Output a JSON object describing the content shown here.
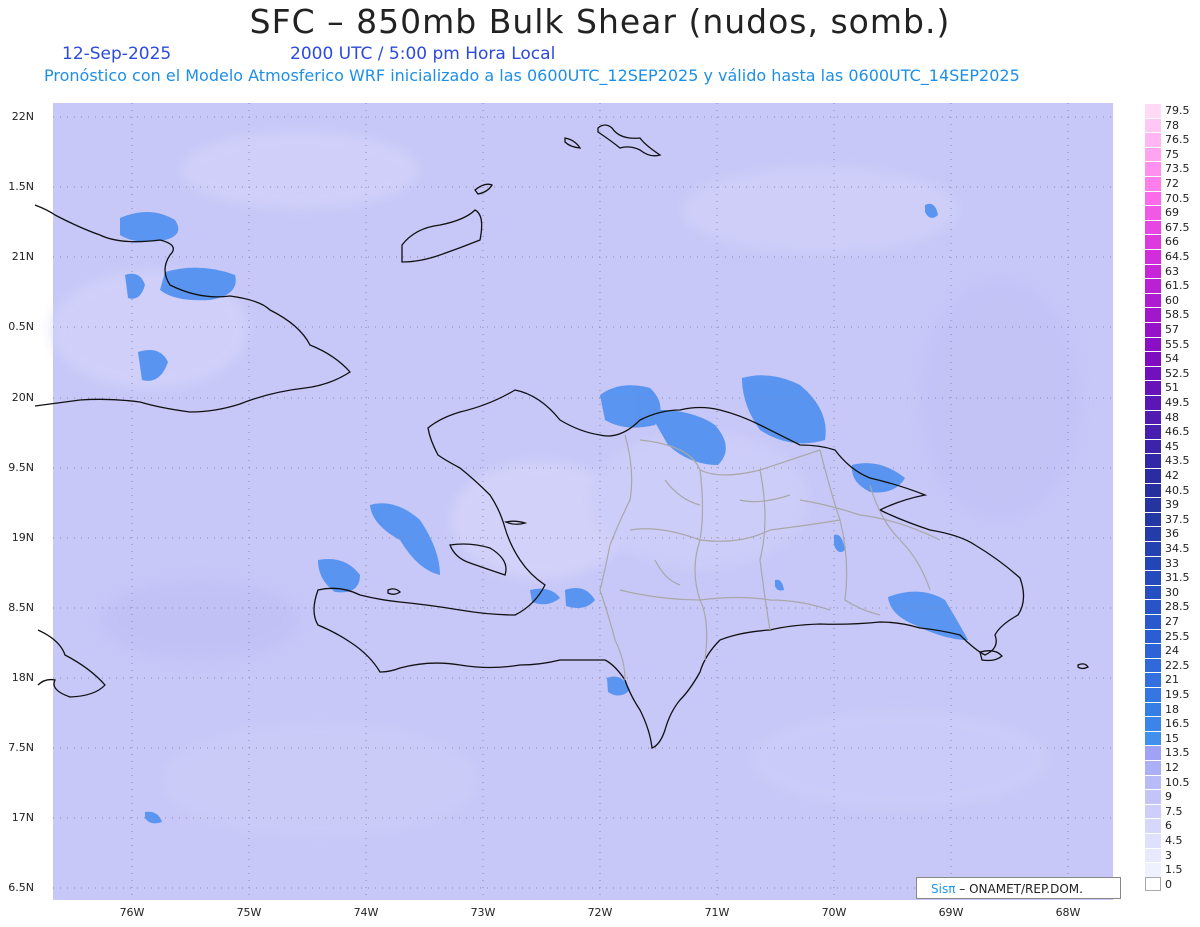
{
  "header": {
    "title": "SFC – 850mb Bulk Shear (nudos, somb.)",
    "date": "12-Sep-2025",
    "time": "2000 UTC / 5:00 pm Hora Local",
    "description": "Pronóstico con el Modelo Atmosferico WRF inicializado a las 0600UTC_12SEP2025 y válido hasta las  0600UTC_14SEP2025"
  },
  "map": {
    "lat_labels": [
      "22N",
      "1.5N",
      "21N",
      "0.5N",
      "20N",
      "9.5N",
      "19N",
      "8.5N",
      "18N",
      "7.5N",
      "17N",
      "6.5N"
    ],
    "lon_labels": [
      "76W",
      "75W",
      "74W",
      "73W",
      "72W",
      "71W",
      "70W",
      "69W",
      "68W"
    ],
    "background_color": "#c7c7f8",
    "shear_color": "#4d8ff0"
  },
  "colorbar": {
    "labels": [
      "79.5",
      "78",
      "76.5",
      "75",
      "73.5",
      "72",
      "70.5",
      "69",
      "67.5",
      "66",
      "64.5",
      "63",
      "61.5",
      "60",
      "58.5",
      "57",
      "55.5",
      "54",
      "52.5",
      "51",
      "49.5",
      "48",
      "46.5",
      "45",
      "43.5",
      "42",
      "40.5",
      "39",
      "37.5",
      "36",
      "34.5",
      "33",
      "31.5",
      "30",
      "28.5",
      "27",
      "25.5",
      "24",
      "22.5",
      "21",
      "19.5",
      "18",
      "16.5",
      "15",
      "13.5",
      "12",
      "10.5",
      "9",
      "7.5",
      "6",
      "4.5",
      "3",
      "1.5",
      "0"
    ],
    "colors": [
      "#ffd9f6",
      "#ffc8f4",
      "#ffb6f2",
      "#ffa4f0",
      "#ff90ee",
      "#ff7eec",
      "#fb6ae9",
      "#f258e6",
      "#e846e2",
      "#de38df",
      "#d22ddc",
      "#c626d8",
      "#ba20d4",
      "#ae1bd0",
      "#a216cc",
      "#9612c9",
      "#8a0fc5",
      "#7e0dc1",
      "#7210bd",
      "#6613b9",
      "#5a17b5",
      "#4f1bb1",
      "#451fae",
      "#3b23aa",
      "#3227a6",
      "#2b2ba2",
      "#272f9e",
      "#2534a0",
      "#2438a4",
      "#233caa",
      "#2341b0",
      "#2445b6",
      "#254abc",
      "#264fc2",
      "#2854c8",
      "#2959cd",
      "#2b5ed2",
      "#2d63d6",
      "#2f69da",
      "#3170de",
      "#3476e2",
      "#377de6",
      "#3b84ea",
      "#4290ee",
      "#a0a3f5",
      "#aeb0f7",
      "#b9bbf8",
      "#c3c5f9",
      "#cdcefa",
      "#d6d7fb",
      "#dfe0fc",
      "#e8e9fd",
      "#f0f1fe",
      "#ffffff"
    ]
  },
  "credit": {
    "sis": "Sisπ",
    "org": "– ONAMET/REP.DOM."
  }
}
